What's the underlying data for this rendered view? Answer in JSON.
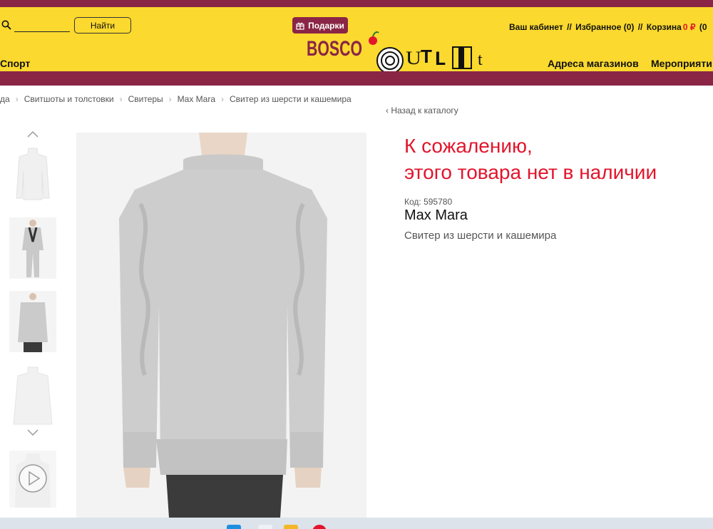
{
  "header": {
    "search": {
      "placeholder": "",
      "value": ""
    },
    "find_label": "Найти",
    "gifts_label": "Подарки",
    "account_links": {
      "cabinet": "Ваш кабинет",
      "sep1": "//",
      "favorites": "Избранное (0)",
      "sep2": "//",
      "cart": "Корзина",
      "cart_amount": "0 ₽",
      "cart_tail": "(0"
    },
    "nav": {
      "sport": "Спорт",
      "stores": "Адреса магазинов",
      "events": "Мероприяти"
    },
    "logo": {
      "word1": "BOSCO",
      "word2": "OUTLET",
      "alt": "Bosco Outlet"
    },
    "colors": {
      "yellow": "#fbd92e",
      "maroon": "#8a2546",
      "red": "#e2152c"
    }
  },
  "breadcrumb": [
    "да",
    "Свитшоты и толстовки",
    "Свитеры",
    "Max Mara",
    "Свитер из шерсти и кашемира"
  ],
  "back_to_catalog": "Назад к каталогу",
  "gallery": {
    "thumbnails": [
      "sweater-front",
      "model-grey-suit",
      "model-grey-sweater",
      "sweater-back",
      "video"
    ],
    "main_image": "model wearing light grey cable-knit turtleneck sweater"
  },
  "product": {
    "unavailable_line1": "К сожалению,",
    "unavailable_line2": "этого товара нет в наличии",
    "code": "Код: 595780",
    "brand": "Max Mara",
    "name": "Свитер из шерсти и кашемира"
  }
}
